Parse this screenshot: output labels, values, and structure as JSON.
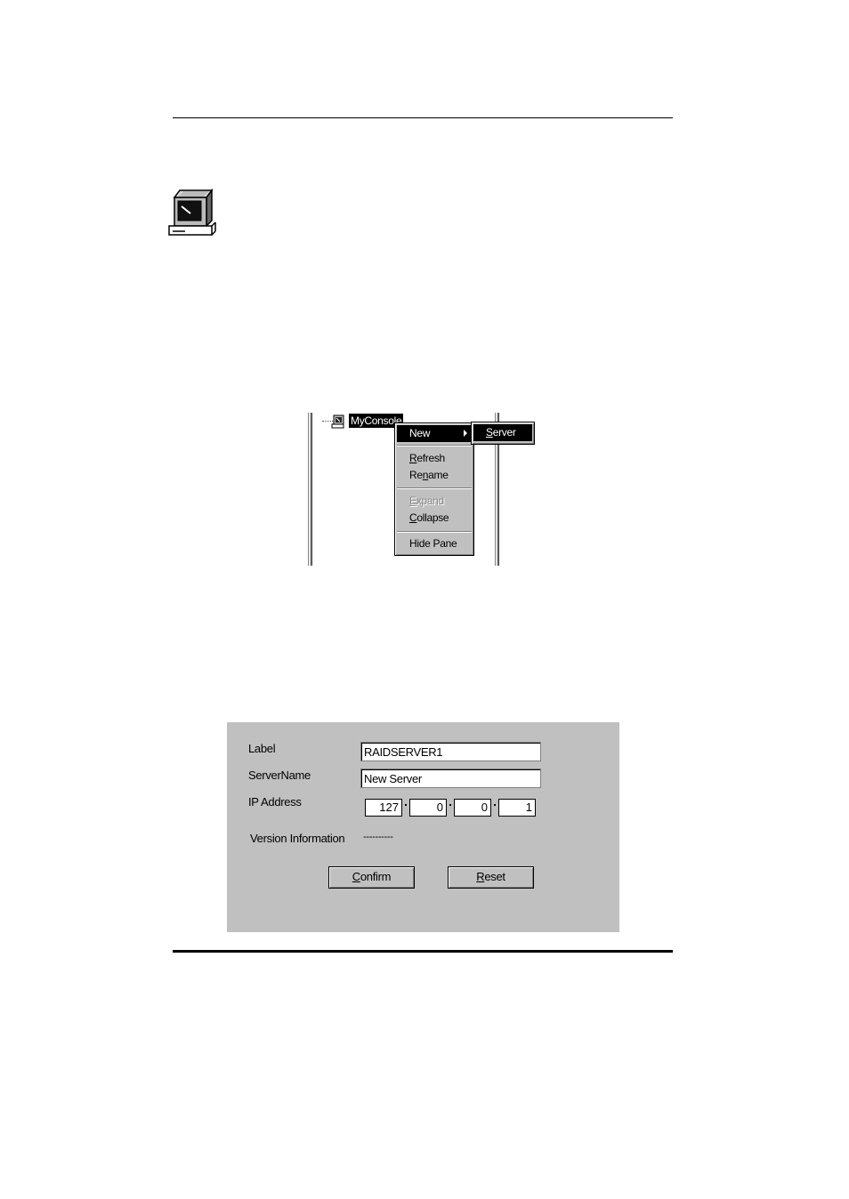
{
  "tree": {
    "root_node": "MyConsole"
  },
  "context_menu": {
    "items": [
      {
        "pre": "",
        "u": "",
        "post": "New"
      },
      {
        "pre": "",
        "u": "R",
        "post": "efresh"
      },
      {
        "pre": "Re",
        "u": "n",
        "post": "ame"
      },
      {
        "pre": "",
        "u": "E",
        "post": "xpand"
      },
      {
        "pre": "",
        "u": "C",
        "post": "ollapse"
      },
      {
        "pre": "",
        "u": "",
        "post": "Hide Pane"
      }
    ],
    "submenu": {
      "pre": "",
      "u": "S",
      "post": "erver"
    }
  },
  "dialog": {
    "label_caption": "Label",
    "label_value": "RAIDSERVER1",
    "servername_caption": "ServerName",
    "servername_value": "New Server",
    "ip_caption": "IP Address",
    "ip": [
      "127",
      "0",
      "0",
      "1"
    ],
    "version_caption": "Version Information",
    "version_value": "----------",
    "confirm": {
      "u": "C",
      "post": "onfirm"
    },
    "reset": {
      "u": "R",
      "post": "eset"
    }
  },
  "colors": {
    "dialog_bg": "#c0c0c0",
    "highlight": "#000000"
  }
}
